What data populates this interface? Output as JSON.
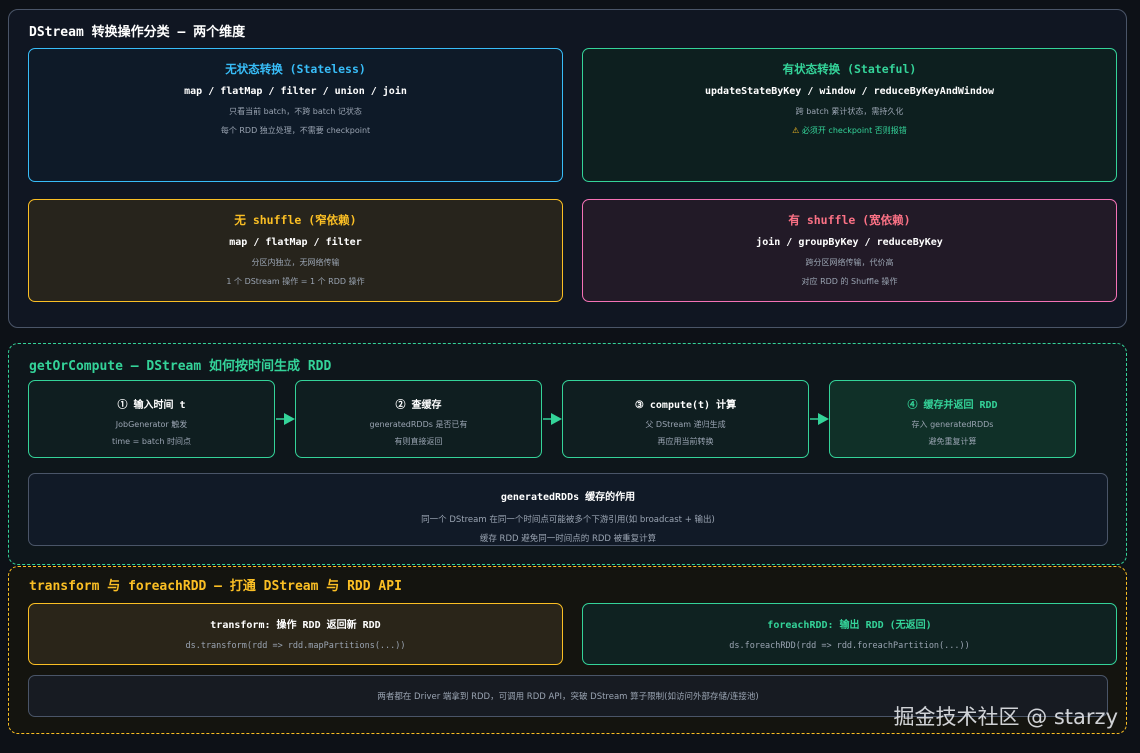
{
  "section1": {
    "title": "DStream 转换操作分类 — 两个维度",
    "stateless": {
      "title": "无状态转换 (Stateless)",
      "ops": "map / flatMap / filter / union / join",
      "desc1": "只看当前 batch，不跨 batch 记状态",
      "desc2": "每个 RDD 独立处理，不需要 checkpoint"
    },
    "stateful": {
      "title": "有状态转换 (Stateful)",
      "ops": "updateStateByKey / window / reduceByKeyAndWindow",
      "desc1": "跨 batch 累计状态，需持久化",
      "warn_icon": "⚠",
      "desc2": "必须开 checkpoint 否则报错"
    },
    "narrow": {
      "title": "无 shuffle (窄依赖)",
      "ops": "map / flatMap / filter",
      "desc1": "分区内独立，无网络传输",
      "desc2": "1 个 DStream 操作 = 1 个 RDD 操作"
    },
    "wide": {
      "title": "有 shuffle (宽依赖)",
      "ops": "join / groupByKey / reduceByKey",
      "desc1": "跨分区网络传输，代价高",
      "desc2": "对应 RDD 的 Shuffle 操作"
    }
  },
  "section2": {
    "title": "getOrCompute — DStream 如何按时间生成 RDD",
    "steps": [
      {
        "title": "① 输入时间 t",
        "desc1": "JobGenerator 触发",
        "desc2": "time = batch 时间点"
      },
      {
        "title": "② 查缓存",
        "desc1": "generatedRDDs 是否已有",
        "desc2": "有则直接返回"
      },
      {
        "title": "③ compute(t) 计算",
        "desc1": "父 DStream 递归生成",
        "desc2": "再应用当前转换"
      },
      {
        "title": "④ 缓存并返回 RDD",
        "desc1": "存入 generatedRDDs",
        "desc2": "避免重复计算"
      }
    ],
    "cache": {
      "title": "generatedRDDs 缓存的作用",
      "desc1": "同一个 DStream 在同一个时间点可能被多个下游引用(如 broadcast + 输出)",
      "desc2": "缓存 RDD 避免同一时间点的 RDD 被重复计算"
    }
  },
  "section3": {
    "title": "transform 与 foreachRDD — 打通 DStream 与 RDD API",
    "transform": {
      "title": "transform: 操作 RDD 返回新 RDD",
      "code": "ds.transform(rdd => rdd.mapPartitions(...))"
    },
    "foreach": {
      "title": "foreachRDD: 输出 RDD (无返回)",
      "code": "ds.foreachRDD(rdd => rdd.foreachPartition(...))"
    },
    "note": "两者都在 Driver 端拿到 RDD，可调用 RDD API，突破 DStream 算子限制(如访问外部存储/连接池)"
  },
  "watermark": "掘金技术社区 @ starzy",
  "colors": {
    "background": "#0d1117",
    "blue": "#38bdf8",
    "green": "#34d399",
    "yellow": "#fbbf24",
    "pink": "#f472b6"
  }
}
